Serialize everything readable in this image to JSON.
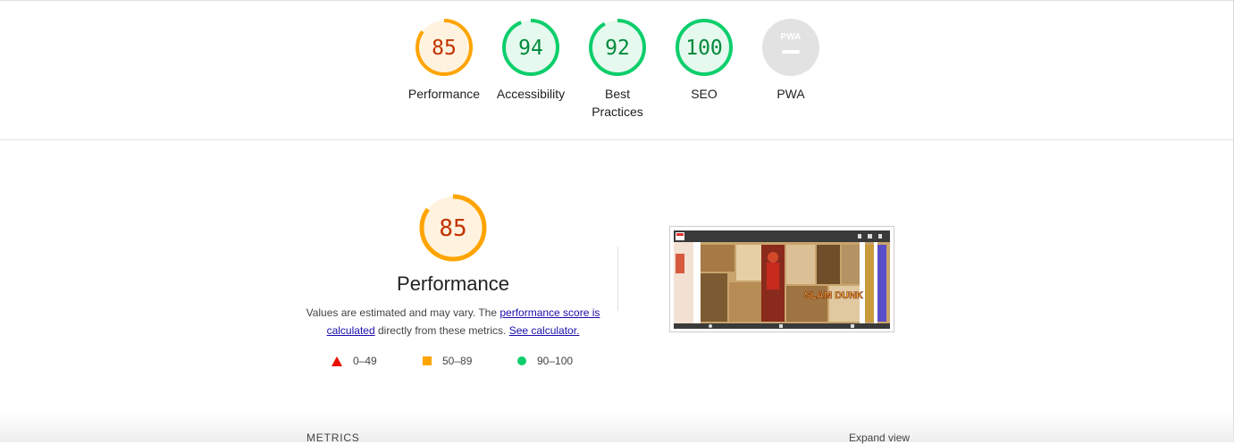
{
  "categories": [
    {
      "label": "Performance",
      "score": "85",
      "value": 0.85,
      "ring": "#ffa400",
      "fill": "#fff3e0",
      "text": "#c33300"
    },
    {
      "label": "Accessibility",
      "score": "94",
      "value": 0.94,
      "ring": "#0cce6b",
      "fill": "#e6f9ee",
      "text": "#018a3b"
    },
    {
      "label": "Best Practices",
      "score": "92",
      "value": 0.92,
      "ring": "#0cce6b",
      "fill": "#e6f9ee",
      "text": "#018a3b"
    },
    {
      "label": "SEO",
      "score": "100",
      "value": 1.0,
      "ring": "#0cce6b",
      "fill": "#e6f9ee",
      "text": "#018a3b"
    },
    {
      "label": "PWA",
      "score": "PWA",
      "value": 0,
      "ring": "#e2e2e2",
      "fill": "#e2e2e2",
      "text": "#ffffff"
    }
  ],
  "performance": {
    "score": "85",
    "value": 0.85,
    "title": "Performance",
    "desc_text_1": "Values are estimated and may vary. The ",
    "desc_link_1": "performance score is calculated",
    "desc_text_2": " directly from these metrics. ",
    "desc_link_2": "See calculator."
  },
  "legend": [
    {
      "shape": "triangle",
      "range": "0–49",
      "color": "#eb0f00"
    },
    {
      "shape": "square",
      "range": "50–89",
      "color": "#ffa400"
    },
    {
      "shape": "circle",
      "range": "90–100",
      "color": "#0cce6b"
    }
  ],
  "screenshot": {
    "logo_text": "SLAM DUNK"
  },
  "metrics": {
    "label": "METRICS",
    "expand": "Expand view"
  }
}
